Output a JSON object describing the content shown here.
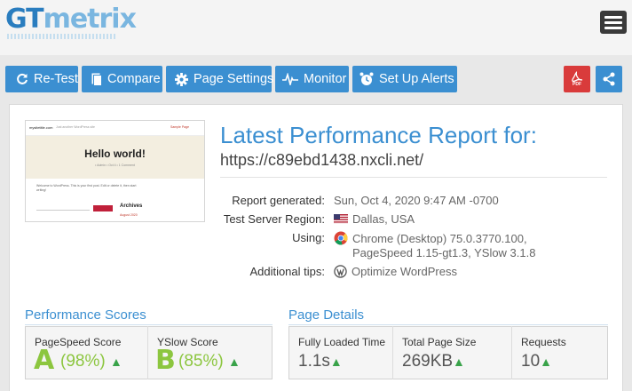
{
  "header": {
    "logo_gt": "GT",
    "logo_metrix": "metrix"
  },
  "toolbar": {
    "retest_label": "Re-Test",
    "compare_label": "Compare",
    "page_settings_label": "Page Settings",
    "monitor_label": "Monitor",
    "alerts_label": "Set Up Alerts",
    "pdf_label": "PDF"
  },
  "thumbnail": {
    "site_name": "mysitetitle.com",
    "site_tagline": "Just another WordPress site",
    "nav_text": "Sample Page",
    "hero_title": "Hello world!",
    "hero_meta": "• Admin • Oct 4 • 1 Comment",
    "body_text": "Welcome to WordPress. This is your first post. Edit or delete it, then start writing!",
    "archives_label": "Archives",
    "archive_month": "August 2020"
  },
  "report": {
    "title": "Latest Performance Report for:",
    "url": "https://c89ebd1438.nxcli.net/",
    "generated_label": "Report generated:",
    "generated_value": "Sun, Oct 4, 2020 9:47 AM -0700",
    "region_label": "Test Server Region:",
    "region_value": "Dallas, USA",
    "using_label": "Using:",
    "using_line1": "Chrome (Desktop) 75.0.3770.100,",
    "using_line2": "PageSpeed 1.15-gt1.3, YSlow 3.1.8",
    "tips_label": "Additional tips:",
    "tips_value": "Optimize WordPress"
  },
  "scores": {
    "title": "Performance Scores",
    "pagespeed_label": "PageSpeed Score",
    "pagespeed_grade": "A",
    "pagespeed_pct": "(98%)",
    "yslow_label": "YSlow Score",
    "yslow_grade": "B",
    "yslow_pct": "(85%)"
  },
  "details": {
    "title": "Page Details",
    "loaded_label": "Fully Loaded Time",
    "loaded_value": "1.1s",
    "size_label": "Total Page Size",
    "size_value": "269KB",
    "requests_label": "Requests",
    "requests_value": "10"
  },
  "colors": {
    "brand_blue": "#3b8fd1",
    "grade_green": "#8cc63f",
    "pdf_red": "#d93b3b",
    "up_green": "#39a34a"
  }
}
